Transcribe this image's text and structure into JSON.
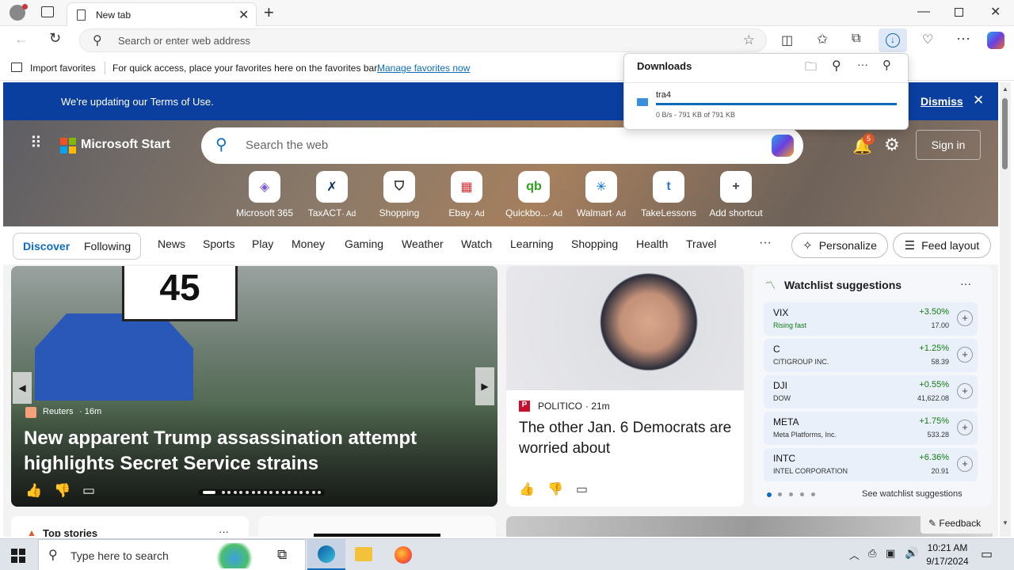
{
  "browser": {
    "tab_title": "New tab",
    "address_placeholder": "Search or enter web address",
    "favbar": {
      "import_label": "Import favorites",
      "message": "For quick access, place your favorites here on the favorites bar.",
      "manage_link": "Manage favorites now"
    }
  },
  "downloads": {
    "title": "Downloads",
    "item": {
      "name": "tra4",
      "status": "0 B/s - 791 KB of 791 KB",
      "progress": 1.0
    }
  },
  "banner": {
    "message": "We're updating our Terms of Use.",
    "dismiss": "Dismiss"
  },
  "header": {
    "brand": "Microsoft Start",
    "search_placeholder": "Search the web",
    "notif_count": "5",
    "sign_in": "Sign in"
  },
  "quicklinks": [
    {
      "label": "Microsoft 365",
      "ad": "",
      "glyph": "◈",
      "color": "#7b5cd6"
    },
    {
      "label": "TaxACT",
      "ad": "· Ad",
      "glyph": "✗",
      "color": "#0d2a5c"
    },
    {
      "label": "Shopping",
      "ad": "",
      "glyph": "⛉",
      "color": "#222222"
    },
    {
      "label": "Ebay",
      "ad": "· Ad",
      "glyph": "▦",
      "color": "#e53238"
    },
    {
      "label": "Quickbo...",
      "ad": "· Ad",
      "glyph": "qb",
      "color": "#2ca01c"
    },
    {
      "label": "Walmart",
      "ad": "· Ad",
      "glyph": "✳",
      "color": "#0071ce"
    },
    {
      "label": "TakeLessons",
      "ad": "",
      "glyph": "t",
      "color": "#2a7bd1"
    },
    {
      "label": "Add shortcut",
      "ad": "",
      "glyph": "+",
      "color": "#444444"
    }
  ],
  "nav": {
    "tabs": [
      "Discover",
      "Following"
    ],
    "items": [
      "News",
      "Sports",
      "Play",
      "Money",
      "Gaming",
      "Weather",
      "Watch",
      "Learning",
      "Shopping",
      "Health",
      "Travel"
    ],
    "more": "···",
    "personalize": "Personalize",
    "feed_layout": "Feed layout"
  },
  "hero_story": {
    "source": "Reuters",
    "time": "· 16m",
    "headline": "New apparent Trump assassination attempt highlights Secret Service strains",
    "sign_text": "45"
  },
  "story2": {
    "source": "POLITICO",
    "time": "· 21m",
    "headline": "The other Jan. 6 Democrats are worried about"
  },
  "watchlist": {
    "title": "Watchlist suggestions",
    "menu": "···",
    "rows": [
      {
        "symbol": "VIX",
        "name": "Rising fast",
        "change": "+3.50%",
        "price": "17.00"
      },
      {
        "symbol": "C",
        "name": "CITIGROUP INC.",
        "change": "+1.25%",
        "price": "58.39"
      },
      {
        "symbol": "DJI",
        "name": "DOW",
        "change": "+0.55%",
        "price": "41,622.08"
      },
      {
        "symbol": "META",
        "name": "Meta Platforms, Inc.",
        "change": "+1.75%",
        "price": "533.28"
      },
      {
        "symbol": "INTC",
        "name": "INTEL CORPORATION",
        "change": "+6.36%",
        "price": "20.91"
      }
    ],
    "see_more": "See watchlist suggestions"
  },
  "bottom": {
    "top_stories": "Top stories",
    "feedback": "Feedback"
  },
  "taskbar": {
    "search_placeholder": "Type here to search",
    "time": "10:21 AM",
    "date": "9/17/2024"
  },
  "colors": {
    "accent": "#0a3fa0",
    "link": "#0f6cbd",
    "positive": "#107c10"
  }
}
